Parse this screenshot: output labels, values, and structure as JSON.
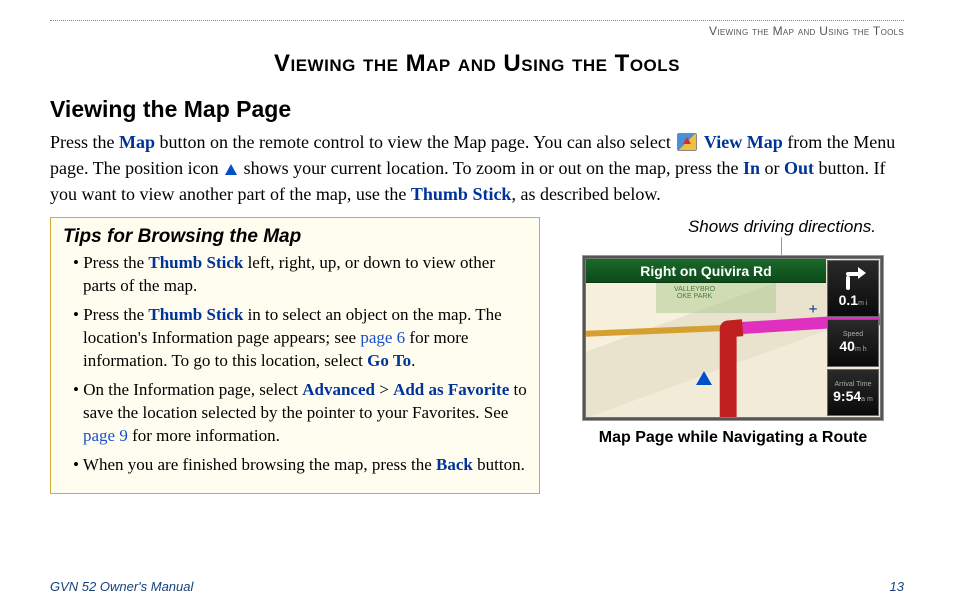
{
  "header": {
    "running_head": "Viewing the Map and Using the Tools"
  },
  "title": "Viewing the Map and Using the Tools",
  "section_title": "Viewing the Map Page",
  "intro": {
    "t1": "Press the ",
    "map": "Map",
    "t2": " button on the remote control to view the Map page. You can also select ",
    "viewmap": "View Map",
    "t3": " from the Menu page. The position icon ",
    "t4": " shows your current location. To zoom in or out on the map, press the ",
    "in": "In",
    "t5": " or ",
    "out": "Out",
    "t6": " button. If you want to view another part of the map, use the ",
    "thumb": "Thumb Stick",
    "t7": ", as described below."
  },
  "tips": {
    "title": "Tips for Browsing the Map",
    "items": [
      {
        "a": "Press the ",
        "b": "Thumb Stick",
        "c": " left, right, up, or down to view other parts of the map."
      },
      {
        "a": "Press the ",
        "b": "Thumb Stick",
        "c": " in to select an object on the map. The location's Information page appears; see ",
        "link": "page 6",
        "d": " for more information. To go to this location, select ",
        "e": "Go To",
        "f": "."
      },
      {
        "a": "On the Information page, select ",
        "b": "Advanced",
        "gt": " > ",
        "c": "Add as Favorite",
        "d": " to save the location selected by the pointer to your Favorites. See ",
        "link": "page 9",
        "e": " for more information."
      },
      {
        "a": "When you are finished browsing the map, press the ",
        "b": "Back",
        "c": " button."
      }
    ]
  },
  "callout": "Shows driving directions.",
  "map": {
    "direction": "Right on Quivira Rd",
    "park1": "VALLEYBRO",
    "park2": "OKE PARK",
    "dist_value": "0.1",
    "dist_unit": "m i",
    "speed_label": "Speed",
    "speed_value": "40",
    "speed_unit": "m h",
    "arrival_label": "Arrival Time",
    "arrival_value": "9:54",
    "arrival_unit": "a m"
  },
  "figure_caption": "Map Page while Navigating a Route",
  "footer": {
    "left": "GVN 52 Owner's Manual",
    "page": "13"
  }
}
